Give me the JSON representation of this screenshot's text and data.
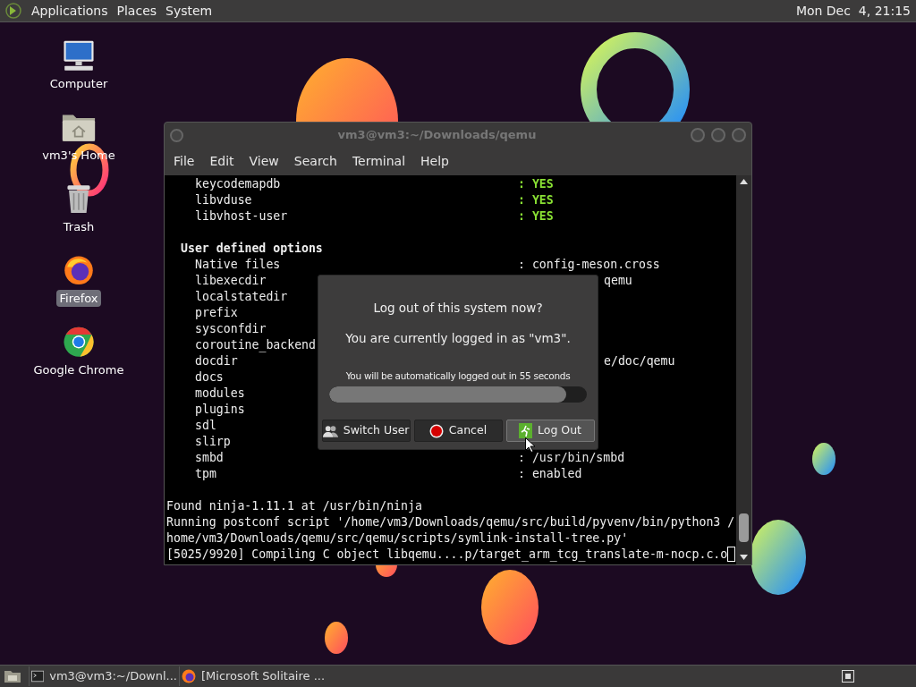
{
  "top_panel": {
    "menus": [
      "Applications",
      "Places",
      "System"
    ],
    "clock": "Mon Dec  4, 21:15"
  },
  "desktop_icons": [
    {
      "kind": "computer",
      "label": "Computer",
      "selected": false
    },
    {
      "kind": "home",
      "label": "vm3's Home",
      "selected": false
    },
    {
      "kind": "trash",
      "label": "Trash",
      "selected": false
    },
    {
      "kind": "firefox",
      "label": "Firefox",
      "selected": true
    },
    {
      "kind": "chrome",
      "label": "Google Chrome",
      "selected": false
    }
  ],
  "terminal": {
    "title": "vm3@vm3:~/Downloads/qemu",
    "menu": [
      "File",
      "Edit",
      "View",
      "Search",
      "Terminal",
      "Help"
    ],
    "lines": [
      {
        "kind": "flag",
        "name": "keycodemapdb",
        "value": ": YES"
      },
      {
        "kind": "flag",
        "name": "libvduse",
        "value": ": YES"
      },
      {
        "kind": "flag",
        "name": "libvhost-user",
        "value": ": YES"
      },
      {
        "kind": "blank"
      },
      {
        "kind": "heading",
        "text": "User defined options"
      },
      {
        "kind": "entry",
        "name": "Native files",
        "value": ": config-meson.cross"
      },
      {
        "kind": "covered",
        "name": "libexecdir",
        "value": "qemu"
      },
      {
        "kind": "covered",
        "name": "localstatedir"
      },
      {
        "kind": "covered",
        "name": "prefix"
      },
      {
        "kind": "covered",
        "name": "sysconfdir"
      },
      {
        "kind": "covered",
        "name": "coroutine_backend"
      },
      {
        "kind": "covered",
        "name": "docdir",
        "value": "e/doc/qemu"
      },
      {
        "kind": "covered",
        "name": "docs"
      },
      {
        "kind": "covered",
        "name": "modules"
      },
      {
        "kind": "covered",
        "name": "plugins"
      },
      {
        "kind": "covered",
        "name": "sdl"
      },
      {
        "kind": "covered",
        "name": "slirp"
      },
      {
        "kind": "entry",
        "name": "smbd",
        "value": ": /usr/bin/smbd"
      },
      {
        "kind": "entry",
        "name": "tpm",
        "value": ": enabled"
      },
      {
        "kind": "blank"
      },
      {
        "kind": "plain",
        "text": "Found ninja-1.11.1 at /usr/bin/ninja"
      },
      {
        "kind": "plain",
        "text": "Running postconf script '/home/vm3/Downloads/qemu/src/build/pyvenv/bin/python3 /"
      },
      {
        "kind": "plain",
        "text": "home/vm3/Downloads/qemu/src/qemu/scripts/symlink-install-tree.py'"
      },
      {
        "kind": "prompt",
        "text": "[5025/9920] Compiling C object libqemu....p/target_arm_tcg_translate-m-nocp.c.o"
      }
    ]
  },
  "logout_dialog": {
    "question": "Log out of this system now?",
    "user_info": "You are currently logged in as \"vm3\".",
    "countdown": "You will be automatically logged out in 55 seconds",
    "level": 0.92,
    "buttons": [
      {
        "kind": "switch",
        "label": "Switch User",
        "selected": false
      },
      {
        "kind": "cancel",
        "label": "Cancel",
        "selected": false
      },
      {
        "kind": "logout",
        "label": "Log Out",
        "selected": true
      }
    ]
  },
  "taskbar": {
    "tasks": [
      {
        "kind": "terminal",
        "label": "vm3@vm3:~/Downl..."
      },
      {
        "kind": "firefox",
        "label": "[Microsoft Solitaire ..."
      }
    ]
  }
}
